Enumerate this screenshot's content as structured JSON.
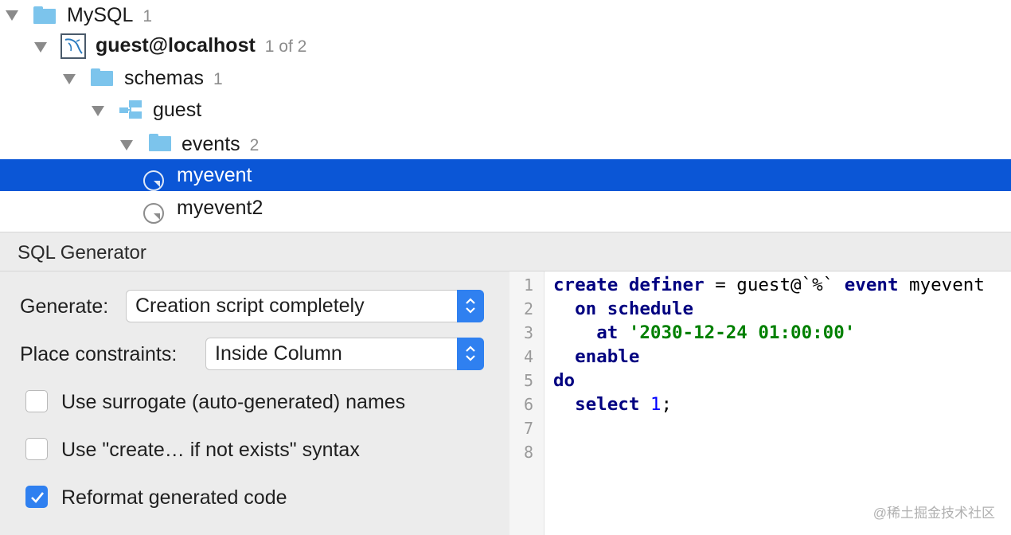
{
  "tree": {
    "root": {
      "label": "MySQL",
      "count": "1"
    },
    "connection": {
      "label": "guest@localhost",
      "count": "1 of 2"
    },
    "schemas": {
      "label": "schemas",
      "count": "1"
    },
    "schema": {
      "label": "guest"
    },
    "events": {
      "label": "events",
      "count": "2"
    },
    "items": [
      {
        "label": "myevent",
        "selected": true
      },
      {
        "label": "myevent2",
        "selected": false
      }
    ]
  },
  "panel": {
    "title": "SQL Generator",
    "generate_label": "Generate:",
    "generate_value": "Creation script completely",
    "constraints_label": "Place constraints:",
    "constraints_value": "Inside Column",
    "checkboxes": [
      {
        "label": "Use surrogate (auto-generated) names",
        "checked": false
      },
      {
        "label": "Use \"create… if not exists\" syntax",
        "checked": false
      },
      {
        "label": "Reformat generated code",
        "checked": true
      }
    ]
  },
  "code": {
    "line_numbers": [
      "1",
      "2",
      "3",
      "4",
      "5",
      "6",
      "7",
      "8"
    ],
    "lines": [
      [
        {
          "t": "create",
          "c": "kw"
        },
        {
          "t": " "
        },
        {
          "t": "definer",
          "c": "kw"
        },
        {
          "t": " = guest@`%` "
        },
        {
          "t": "event",
          "c": "kw"
        },
        {
          "t": " myevent"
        }
      ],
      [
        {
          "t": "  "
        },
        {
          "t": "on schedule",
          "c": "kw"
        }
      ],
      [
        {
          "t": "    "
        },
        {
          "t": "at",
          "c": "kw"
        },
        {
          "t": " "
        },
        {
          "t": "'2030-12-24 01:00:00'",
          "c": "str"
        }
      ],
      [
        {
          "t": "  "
        },
        {
          "t": "enable",
          "c": "kw"
        }
      ],
      [
        {
          "t": "do",
          "c": "kw"
        }
      ],
      [
        {
          "t": "  "
        },
        {
          "t": "select",
          "c": "kw"
        },
        {
          "t": " "
        },
        {
          "t": "1",
          "c": "num"
        },
        {
          "t": ";"
        }
      ],
      [],
      []
    ]
  },
  "watermark": "@稀土掘金技术社区",
  "colors": {
    "selection": "#0b56d6",
    "accent": "#2f80f0",
    "folder": "#7cc4ec",
    "keyword": "#000080",
    "string": "#008000",
    "number": "#0000ff"
  }
}
